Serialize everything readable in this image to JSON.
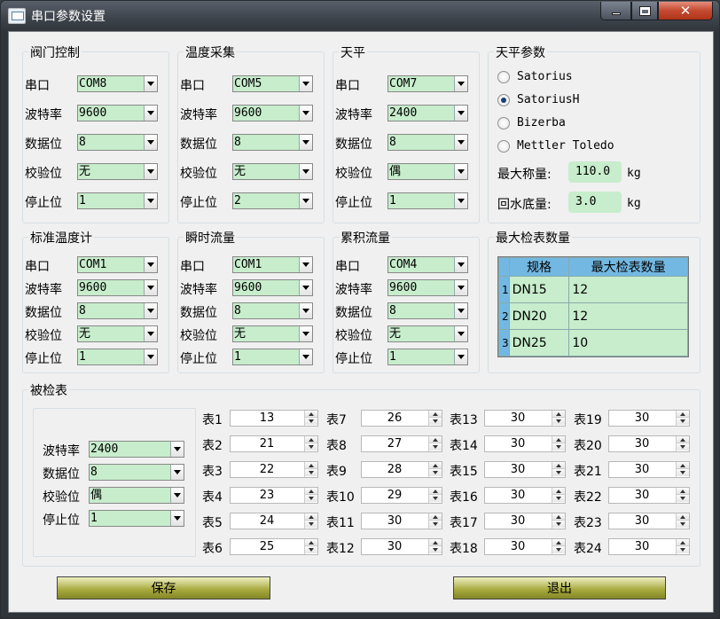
{
  "window": {
    "title": "串口参数设置"
  },
  "groups": {
    "valve": {
      "title": "阀门控制",
      "port": "COM8",
      "baud": "9600",
      "databits": "8",
      "parity": "无",
      "stopbits": "1"
    },
    "temp": {
      "title": "温度采集",
      "port": "COM5",
      "baud": "9600",
      "databits": "8",
      "parity": "无",
      "stopbits": "2"
    },
    "balance": {
      "title": "天平",
      "port": "COM7",
      "baud": "2400",
      "databits": "8",
      "parity": "偶",
      "stopbits": "1"
    },
    "stdtemp": {
      "title": "标准温度计",
      "port": "COM1",
      "baud": "9600",
      "databits": "8",
      "parity": "无",
      "stopbits": "1"
    },
    "flow": {
      "title": "瞬时流量",
      "port": "COM1",
      "baud": "9600",
      "databits": "8",
      "parity": "无",
      "stopbits": "1"
    },
    "cumflow": {
      "title": "累积流量",
      "port": "COM4",
      "baud": "9600",
      "databits": "8",
      "parity": "无",
      "stopbits": "1"
    }
  },
  "labels": {
    "port": "串口",
    "baud": "波特率",
    "databits": "数据位",
    "parity": "校验位",
    "stopbits": "停止位"
  },
  "balance_params": {
    "title": "天平参数",
    "options": [
      "Satorius",
      "SatoriusH",
      "Bizerba",
      "Mettler Toledo"
    ],
    "selected": "SatoriusH",
    "max_weight_label": "最大称量:",
    "max_weight": "110.0",
    "bottom_label": "回水底量:",
    "bottom_value": "3.0",
    "unit": "kg"
  },
  "max_meters": {
    "title": "最大检表数量",
    "headers": [
      "规格",
      "最大检表数量"
    ],
    "rows": [
      {
        "n": "1",
        "spec": "DN15",
        "count": "12"
      },
      {
        "n": "2",
        "spec": "DN20",
        "count": "12"
      },
      {
        "n": "3",
        "spec": "DN25",
        "count": "10"
      }
    ]
  },
  "meters_section": {
    "title": "被检表",
    "baud": "2400",
    "databits": "8",
    "parity": "偶",
    "stopbits": "1",
    "meters": [
      {
        "label": "表1",
        "value": "13"
      },
      {
        "label": "表2",
        "value": "21"
      },
      {
        "label": "表3",
        "value": "22"
      },
      {
        "label": "表4",
        "value": "23"
      },
      {
        "label": "表5",
        "value": "24"
      },
      {
        "label": "表6",
        "value": "25"
      },
      {
        "label": "表7",
        "value": "26"
      },
      {
        "label": "表8",
        "value": "27"
      },
      {
        "label": "表9",
        "value": "28"
      },
      {
        "label": "表10",
        "value": "29"
      },
      {
        "label": "表11",
        "value": "30"
      },
      {
        "label": "表12",
        "value": "30"
      },
      {
        "label": "表13",
        "value": "30"
      },
      {
        "label": "表14",
        "value": "30"
      },
      {
        "label": "表15",
        "value": "30"
      },
      {
        "label": "表16",
        "value": "30"
      },
      {
        "label": "表17",
        "value": "30"
      },
      {
        "label": "表18",
        "value": "30"
      },
      {
        "label": "表19",
        "value": "30"
      },
      {
        "label": "表20",
        "value": "30"
      },
      {
        "label": "表21",
        "value": "30"
      },
      {
        "label": "表22",
        "value": "30"
      },
      {
        "label": "表23",
        "value": "30"
      },
      {
        "label": "表24",
        "value": "30"
      }
    ]
  },
  "buttons": {
    "save": "保存",
    "exit": "退出"
  },
  "colors": {
    "field_bg": "#c7edcc",
    "grid_header": "#72b8e2",
    "button": "#a6a83c"
  }
}
